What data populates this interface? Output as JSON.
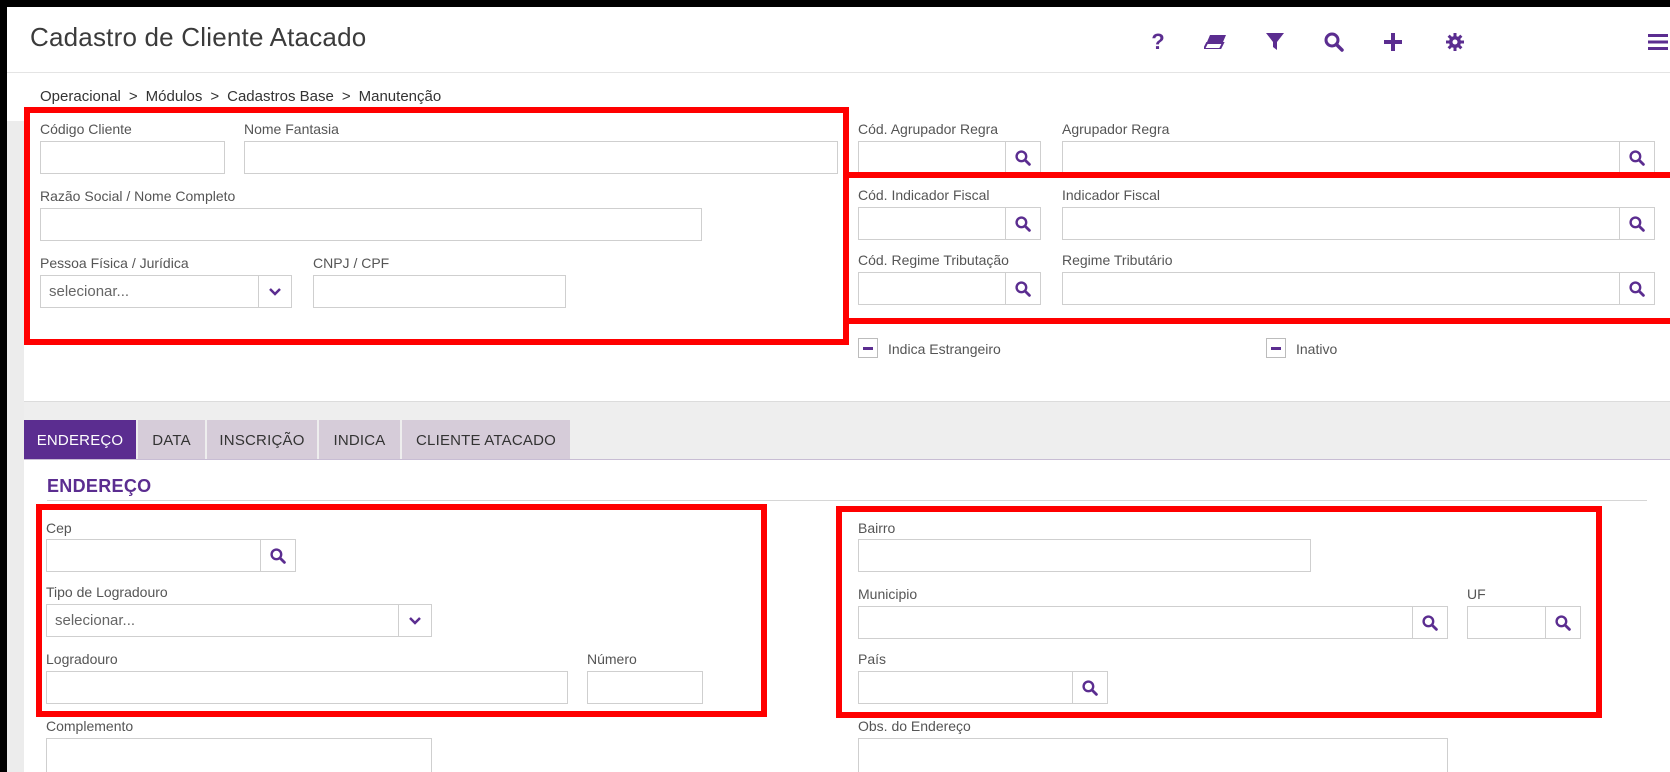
{
  "header": {
    "title": "Cadastro de Cliente Atacado",
    "icons": [
      "help-icon",
      "eraser-icon",
      "filter-icon",
      "search-icon",
      "plus-icon",
      "gear-icon",
      "menu-icon"
    ]
  },
  "breadcrumb": {
    "items": [
      "Operacional",
      "Módulos",
      "Cadastros Base",
      "Manutenção"
    ],
    "separator": ">"
  },
  "form": {
    "codigo_cliente_label": "Código Cliente",
    "codigo_cliente_value": "",
    "nome_fantasia_label": "Nome Fantasia",
    "nome_fantasia_value": "",
    "razao_social_label": "Razão Social / Nome Completo",
    "razao_social_value": "",
    "pessoa_label": "Pessoa Física / Jurídica",
    "pessoa_value": "selecionar...",
    "cnpj_label": "CNPJ / CPF",
    "cnpj_value": "",
    "cod_agrupador_label": "Cód. Agrupador Regra",
    "agrupador_label": "Agrupador Regra",
    "cod_indicador_label": "Cód. Indicador Fiscal",
    "indicador_label": "Indicador Fiscal",
    "cod_regime_label": "Cód. Regime Tributação",
    "regime_label": "Regime Tributário",
    "estrangeiro_label": "Indica Estrangeiro",
    "inativo_label": "Inativo"
  },
  "tabs": [
    {
      "label": "ENDEREÇO",
      "active": true
    },
    {
      "label": "DATA",
      "active": false
    },
    {
      "label": "INSCRIÇÃO",
      "active": false
    },
    {
      "label": "INDICA",
      "active": false
    },
    {
      "label": "CLIENTE ATACADO",
      "active": false
    }
  ],
  "endereco": {
    "section_title": "ENDEREÇO",
    "cep_label": "Cep",
    "tipo_logradouro_label": "Tipo de Logradouro",
    "tipo_logradouro_value": "selecionar...",
    "logradouro_label": "Logradouro",
    "numero_label": "Número",
    "complemento_label": "Complemento",
    "bairro_label": "Bairro",
    "municipio_label": "Municipio",
    "uf_label": "UF",
    "pais_label": "País",
    "obs_label": "Obs. do Endereço"
  },
  "colors": {
    "accent": "#5b2d90",
    "highlight": "#ff0000",
    "tab_inactive": "#d6ccd9"
  }
}
